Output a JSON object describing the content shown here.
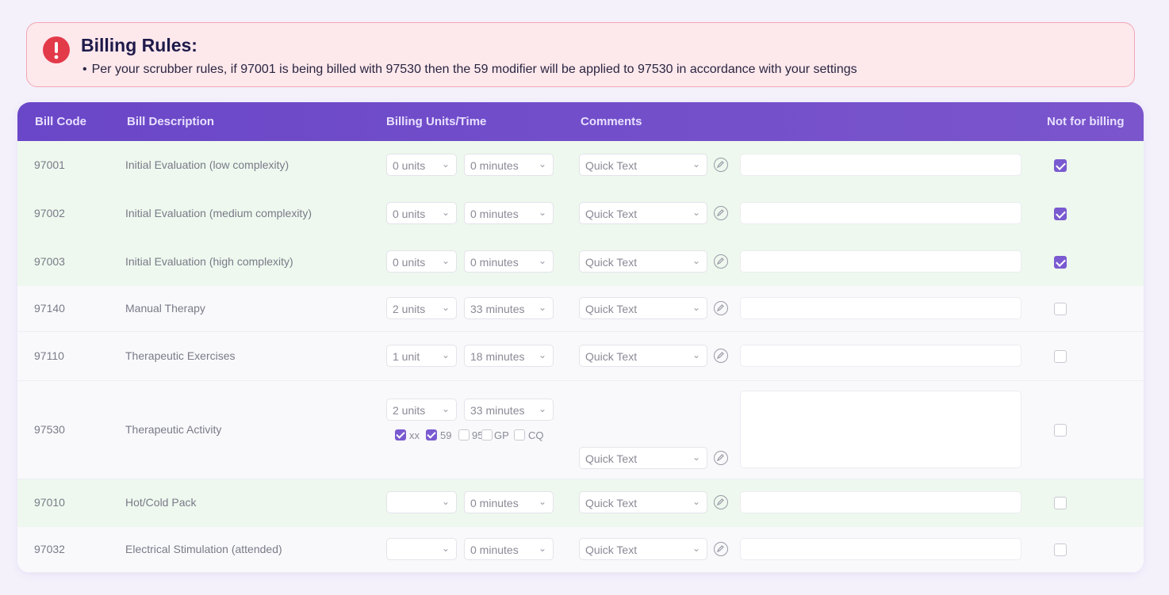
{
  "alert": {
    "title": "Billing Rules:",
    "bullet": "•",
    "message": "Per your scrubber rules, if 97001 is being billed with 97530 then the 59 modifier will be applied to 97530 in accordance with your settings"
  },
  "columns": {
    "code": "Bill Code",
    "description": "Bill Description",
    "units_time": "Billing Units/Time",
    "comments": "Comments",
    "not_billing": "Not for billing"
  },
  "quick_text_label": "Quick Text",
  "rows": [
    {
      "code": "97001",
      "description": "Initial Evaluation (low complexity)",
      "units": "0 units",
      "minutes": "0 minutes",
      "not_for_billing": true
    },
    {
      "code": "97002",
      "description": "Initial Evaluation (medium complexity)",
      "units": "0 units",
      "minutes": "0 minutes",
      "not_for_billing": true
    },
    {
      "code": "97003",
      "description": "Initial Evaluation (high complexity)",
      "units": "0 units",
      "minutes": "0 minutes",
      "not_for_billing": true
    },
    {
      "code": "97140",
      "description": "Manual Therapy",
      "units": "2 units",
      "minutes": "33 minutes",
      "not_for_billing": false
    },
    {
      "code": "97110",
      "description": "Therapeutic Exercises",
      "units": "1 unit",
      "minutes": "18 minutes",
      "not_for_billing": false
    },
    {
      "code": "97530",
      "description": "Therapeutic Activity",
      "units": "2 units",
      "minutes": "33 minutes",
      "not_for_billing": false,
      "modifiers": [
        {
          "label": "xx",
          "checked": true
        },
        {
          "label": "59",
          "checked": true
        },
        {
          "label": "95",
          "checked": false
        },
        {
          "label": "GP",
          "checked": false
        },
        {
          "label": "CQ",
          "checked": false
        }
      ]
    },
    {
      "code": "97010",
      "description": "Hot/Cold Pack",
      "units": "",
      "minutes": "0 minutes",
      "not_for_billing": false
    },
    {
      "code": "97032",
      "description": "Electrical Stimulation (attended)",
      "units": "",
      "minutes": "0 minutes",
      "not_for_billing": false
    }
  ],
  "icons": {
    "alert": "exclamation-circle-icon",
    "edit": "pencil-circle-icon",
    "dropdown": "chevron-down-icon"
  },
  "colors": {
    "header": "#6a47c8",
    "alert_bg": "#fde8ec",
    "alert_icon": "#e33a4a",
    "row_green": "#eef8ee",
    "checkbox": "#7a5ad0"
  }
}
